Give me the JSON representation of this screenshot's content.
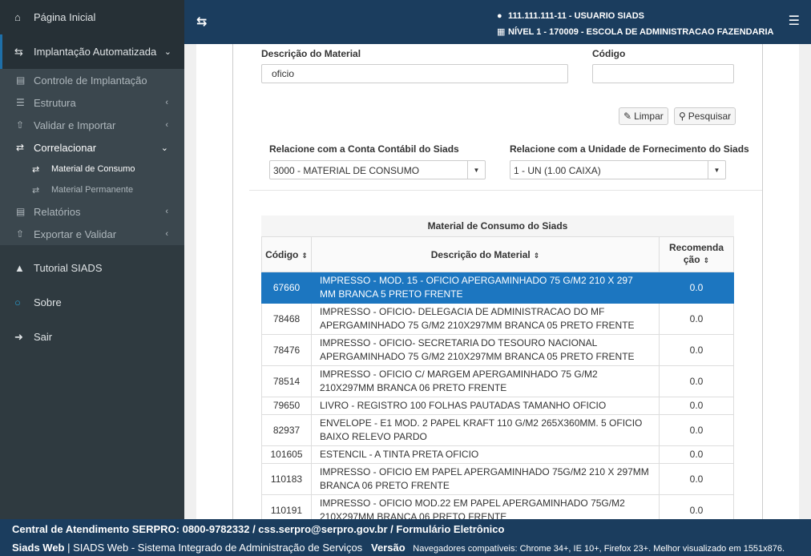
{
  "sidebar": {
    "home": {
      "icon": "home-icon",
      "label": "Página Inicial"
    },
    "implantacao": {
      "icon": "exchange-icon",
      "label": "Implantação Automatizada"
    },
    "sub": [
      {
        "icon": "list-icon",
        "label": "Controle de Implantação"
      },
      {
        "icon": "structure-icon",
        "label": "Estrutura"
      },
      {
        "icon": "upload-icon",
        "label": "Validar e Importar"
      },
      {
        "icon": "shuffle-icon",
        "label": "Correlacionar"
      }
    ],
    "sub2": [
      {
        "icon": "shuffle-icon",
        "label": "Material de Consumo"
      },
      {
        "icon": "shuffle-icon",
        "label": "Material Permanente"
      }
    ],
    "sub_after": [
      {
        "icon": "report-icon",
        "label": "Relatórios"
      },
      {
        "icon": "export-icon",
        "label": "Exportar e Validar"
      }
    ],
    "lower": [
      {
        "icon": "graduation-cap-icon",
        "label": "Tutorial SIADS"
      },
      {
        "icon": "circle-icon",
        "label": "Sobre"
      },
      {
        "icon": "sign-out-icon",
        "label": "Sair"
      }
    ]
  },
  "header": {
    "user_line": "111.111.111-11 - USUARIO SIADS",
    "level_line": "NÍVEL 1 - 170009 - ESCOLA DE ADMINISTRACAO FAZENDARIA"
  },
  "form": {
    "descricao_label": "Descrição do Material",
    "descricao_value": "oficio",
    "codigo_label": "Código",
    "codigo_value": "",
    "limpar": "Limpar",
    "pesquisar": "Pesquisar",
    "conta_label": "Relacione com a Conta Contábil do Siads",
    "conta_value": "3000 - MATERIAL DE CONSUMO",
    "unidade_label": "Relacione com a Unidade de Fornecimento do Siads",
    "unidade_value": "1 - UN (1.00 CAIXA)"
  },
  "table": {
    "caption": "Material de Consumo do Siads",
    "headers": {
      "codigo": "Código",
      "descricao": "Descrição do Material",
      "recomendacao_1": "Recomenda",
      "recomendacao_2": "ção"
    },
    "rows": [
      {
        "codigo": "67660",
        "descricao": "IMPRESSO - MOD. 15 - OFICIO APERGAMINHADO 75 G/M2 210 X 297 MM BRANCA 5 PRETO FRENTE",
        "rec": "0.0"
      },
      {
        "codigo": "78468",
        "descricao": "IMPRESSO - OFICIO- DELEGACIA DE ADMINISTRACAO DO MF APERGAMINHADO 75 G/M2 210X297MM BRANCA 05 PRETO FRENTE",
        "rec": "0.0"
      },
      {
        "codigo": "78476",
        "descricao": "IMPRESSO - OFICIO- SECRETARIA DO TESOURO NACIONAL APERGAMINHADO 75 G/M2 210X297MM BRANCA 05 PRETO FRENTE",
        "rec": "0.0"
      },
      {
        "codigo": "78514",
        "descricao": "IMPRESSO - OFICIO C/ MARGEM APERGAMINHADO 75 G/M2 210X297MM BRANCA 06 PRETO FRENTE",
        "rec": "0.0"
      },
      {
        "codigo": "79650",
        "descricao": "LIVRO - REGISTRO 100 FOLHAS PAUTADAS TAMANHO OFICIO",
        "rec": "0.0"
      },
      {
        "codigo": "82937",
        "descricao": "ENVELOPE - E1 MOD. 2 PAPEL KRAFT 110 G/M2 265X360MM. 5 OFICIO BAIXO RELEVO PARDO",
        "rec": "0.0"
      },
      {
        "codigo": "101605",
        "descricao": "ESTENCIL - A TINTA PRETA OFICIO",
        "rec": "0.0"
      },
      {
        "codigo": "110183",
        "descricao": "IMPRESSO - OFICIO EM PAPEL APERGAMINHADO 75G/M2 210 X 297MM BRANCA 06 PRETO FRENTE",
        "rec": "0.0"
      },
      {
        "codigo": "110191",
        "descricao": "IMPRESSO - OFICIO MOD.22 EM PAPEL APERGAMINHADO 75G/M2 210X297MM BRANCA 06 PRETO FRENTE",
        "rec": "0.0"
      }
    ]
  },
  "footer": {
    "line1": "Central de Atendimento SERPRO: 0800-9782332 / css.serpro@serpro.gov.br / Formulário Eletrônico",
    "app_name": "Siads Web",
    "app_desc": "| SIADS Web - Sistema Integrado de Administração de Serviços",
    "versao_label": "Versão",
    "browsers": "Navegadores compatíveis: Chrome 34+, IE 10+, Firefox 23+. Melhor visualizado em 1551x876."
  },
  "colors": {
    "sidebar_bg": "#2f3a40",
    "header_bg": "#1b3d5e",
    "selected_row": "#1c76c0"
  }
}
